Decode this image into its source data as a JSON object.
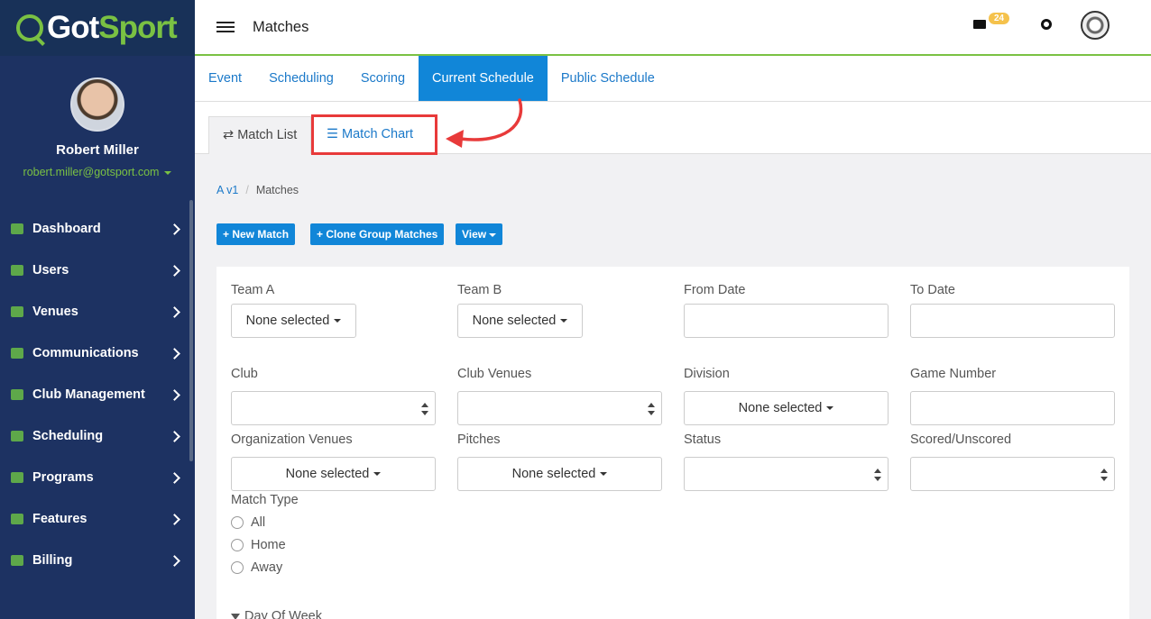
{
  "brand": {
    "name_main": "Got",
    "name_accent": "Sport"
  },
  "user": {
    "name": "Robert Miller",
    "email": "robert.miller@gotsport.com"
  },
  "nav": [
    {
      "label": "Dashboard",
      "icon": "dashboard-icon"
    },
    {
      "label": "Users",
      "icon": "users-icon"
    },
    {
      "label": "Venues",
      "icon": "home-icon"
    },
    {
      "label": "Communications",
      "icon": "chat-icon"
    },
    {
      "label": "Club Management",
      "icon": "list-icon"
    },
    {
      "label": "Scheduling",
      "icon": "calendar-icon"
    },
    {
      "label": "Programs",
      "icon": "document-icon"
    },
    {
      "label": "Features",
      "icon": "star-icon"
    },
    {
      "label": "Billing",
      "icon": "credit-card-icon"
    }
  ],
  "header": {
    "title": "Matches",
    "mail_count": "24"
  },
  "tabs": [
    "Event",
    "Scheduling",
    "Scoring",
    "Current Schedule",
    "Public Schedule"
  ],
  "active_tab": "Current Schedule",
  "subtabs": {
    "match_list": "Match List",
    "match_chart": "Match Chart"
  },
  "breadcrumb": {
    "link": "A v1",
    "current": "Matches"
  },
  "actions": {
    "new_match": "+ New Match",
    "clone_group": "+ Clone Group Matches",
    "view": "View"
  },
  "filters": {
    "team_a": {
      "label": "Team A",
      "value": "None selected"
    },
    "team_b": {
      "label": "Team B",
      "value": "None selected"
    },
    "from_date": {
      "label": "From Date"
    },
    "to_date": {
      "label": "To Date"
    },
    "club": {
      "label": "Club"
    },
    "club_venues": {
      "label": "Club Venues"
    },
    "division": {
      "label": "Division",
      "value": "None selected"
    },
    "game_number": {
      "label": "Game Number"
    },
    "org_venues": {
      "label": "Organization Venues",
      "value": "None selected"
    },
    "pitches": {
      "label": "Pitches",
      "value": "None selected"
    },
    "status": {
      "label": "Status"
    },
    "scored": {
      "label": "Scored/Unscored"
    },
    "match_type": {
      "label": "Match Type",
      "options": [
        "All",
        "Home",
        "Away"
      ]
    },
    "day_of_week": {
      "label": "Day Of Week"
    }
  },
  "colors": {
    "brand_green": "#7ac143",
    "sidebar_bg": "#1d3262",
    "primary_blue": "#1186d8",
    "highlight_red": "#e83a3a"
  }
}
